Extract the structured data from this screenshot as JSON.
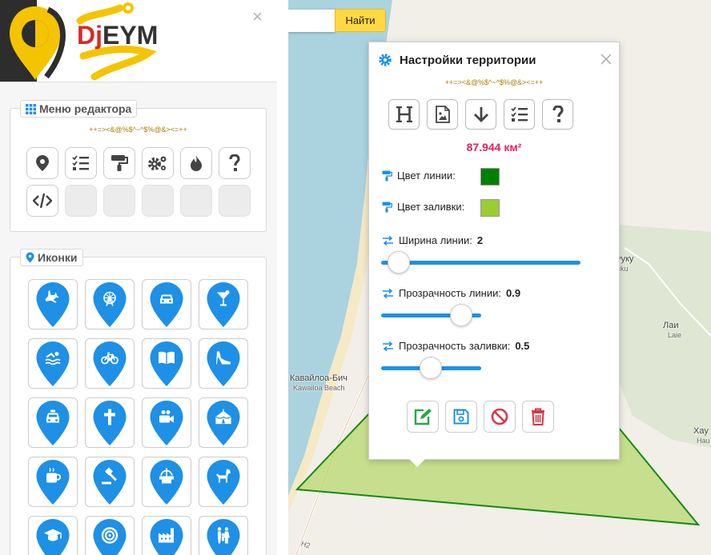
{
  "logo": {
    "text_left": "Dj",
    "text_right": "EYM"
  },
  "sidebar": {
    "close_label": "×",
    "editor_menu": {
      "title": "Меню редактора",
      "code": "++=><&@%$^~^$%@&><=++",
      "tools_row1": [
        "location-pin-icon",
        "checklist-icon",
        "paint-roller-icon",
        "gears-icon",
        "fire-icon",
        "question-icon"
      ],
      "tools_row2": [
        "code-icon",
        "",
        "",
        "",
        "",
        ""
      ]
    },
    "icons_panel": {
      "title": "Иконки",
      "markers": [
        "airplane-icon",
        "ferris-wheel-icon",
        "car-icon",
        "cocktail-icon",
        "swimming-icon",
        "bicycle-icon",
        "book-icon",
        "high-heel-icon",
        "taxi-icon",
        "cross-icon",
        "video-camera-icon",
        "circus-tent-icon",
        "coffee-icon",
        "gavel-icon",
        "fountain-icon",
        "dog-icon",
        "graduation-cap-icon",
        "target-icon",
        "factory-icon",
        "family-icon"
      ]
    }
  },
  "map": {
    "search_placeholder": "",
    "search_button": "Найти",
    "labels": {
      "kawailoa_ru": "Кавайлоа-Бич",
      "kawailoa_en": "Kawailoa Beach",
      "laie_ru": "Лаи",
      "laie_en": "Laie",
      "kuku_ru": "ууку",
      "kuku_en": "uku",
      "hau_ru": "Хау",
      "hau_en": "Hau",
      "road": "H2"
    },
    "territory": {
      "line_color": "#008000",
      "fill_color": "#9acd32"
    }
  },
  "popup": {
    "title": "Настройки территории",
    "code": "++=><&@%$^~^$%@&><=++",
    "toolbar": [
      "heading-icon",
      "image-file-icon",
      "arrow-down-icon",
      "checklist-icon",
      "question-icon"
    ],
    "area": "87.944 км²",
    "line_color_label": "Цвет линии:",
    "line_color": "#008000",
    "fill_color_label": "Цвет заливки:",
    "fill_color": "#9acd32",
    "line_width_label": "Ширина линии:",
    "line_width_value": "2",
    "line_opacity_label": "Прозрачность линии:",
    "line_opacity_value": "0.9",
    "fill_opacity_label": "Прозрачность заливки:",
    "fill_opacity_value": "0.5",
    "actions": [
      "edit-icon",
      "save-icon",
      "cancel-icon",
      "trash-icon"
    ],
    "colors": {
      "accent": "#1e90e6",
      "area": "#e0245e",
      "edit": "#28a745",
      "save": "#1e90e6",
      "cancel": "#dc3545",
      "delete": "#dc3545"
    }
  }
}
